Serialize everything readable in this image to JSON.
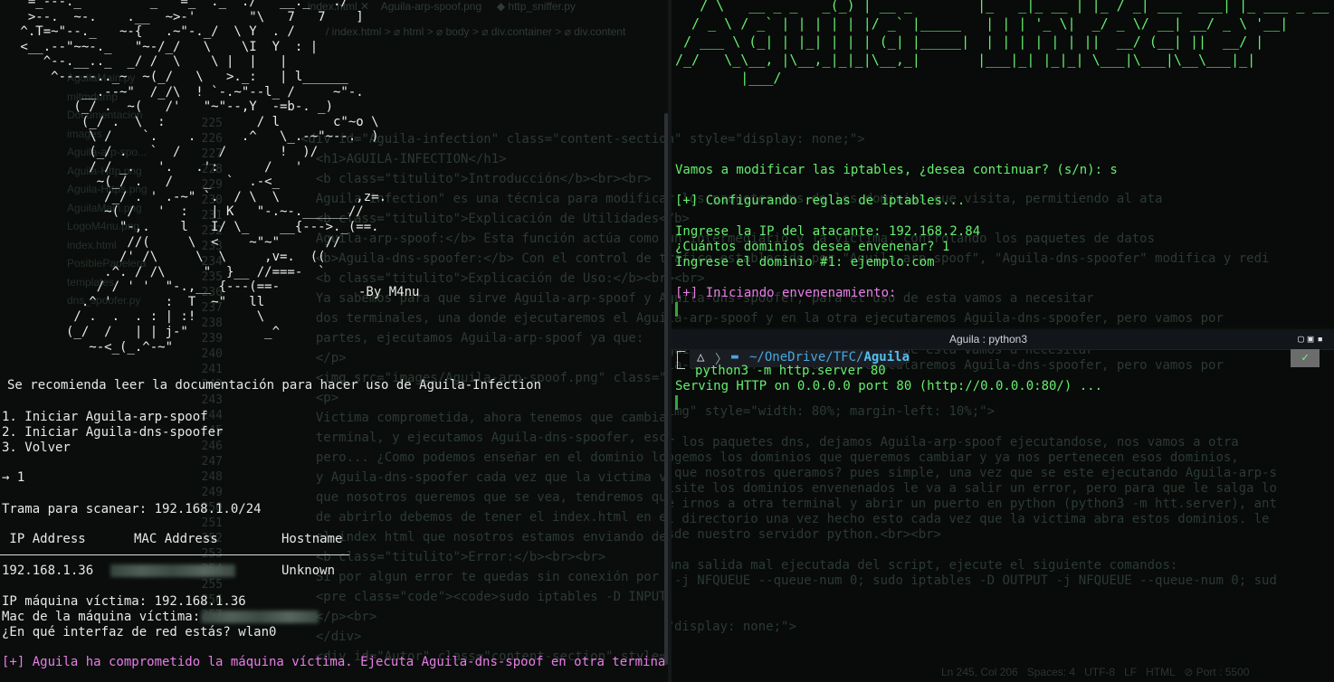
{
  "left": {
    "ascii_logo": "  =_---._         _   =_  ._  ./   __._   ./\n  >--.  ~-.    .__  ~>-'       \"\\   7   7    ]\n ^.T=~\"--._   ~-{   .~\"-._/  \\ Y  . /\n <__.--\"~~-._   \"~-/_/   \\    \\I  Y  : |\n    ^--.__.._  _/ /  \\    \\ |  |   |    \n     ^-----.._~  ~(_/   \\   >._:   | l______\n         __.--~\"  /_/\\  ! `-.~\"--l_ /     ~\"-.\n        (_/ .  ~(   /'   \"~\"--,Y  -=b-. _)\n         (_/ .  \\  :            / l       c\"~o \\\n          \\ /    `.    .      .^   \\_.-~\"~--.  )\n          (_/ .   `  /     /       !  )/\n          / / _.   '.   .':      /   '\n           ~(_/ .   /    _  `  .-<_\n            /_/ . ' .-~\" `.  / \\  \\          ,z=.\n            ~( /   '  :   | K   \"-.~-.______//\n              \"-,.    l   I/ \\_    __{--->._(==.\n               //(     \\  <    ~\"~\"      //\n              /' /\\     \\  \\     ,v=.  ((\n            .^. / /\\     \"  }__ //===-  `\n           / / ' '  \"-.,__ {---(==-\n         .^ '       :  T  ~\"   ll\n        / .  .  . : | :!        \\\n       (_/  /   | | j-\"          _^\n          ~-<_(_.^-~\"",
    "signature": "-By M4nu",
    "recommend": "Se recomienda leer la documentación para hacer uso de Aguila-Infection",
    "menu": [
      "1. Iniciar Aguila-arp-spoof",
      "2. Iniciar Aguila-dns-spoofer",
      "3. Volver"
    ],
    "prompt_arrow": "→ 1",
    "scan_line": "Trama para scanear: 192.168.1.0/24",
    "table_headers": [
      " IP Address",
      "MAC Address",
      "Hostname"
    ],
    "table_rows": [
      {
        "ip": "192.168.1.36",
        "hostname": "Unknown"
      }
    ],
    "ip_victim": "IP máquina víctima: 192.168.1.36",
    "mac_victim": "Mac de la máquina víctima:",
    "interface": "¿En qué interfaz de red estás? wlan0",
    "compromised": "[+] Aguila ha comprometido la máquina víctima. Ejecuta Aguila-dns-spoof en otra terminal para"
  },
  "underlay": {
    "tabs": "index.html ✕    Aguila-arp-spoof.png     ◆ http_sniffer.py",
    "breadcrumb": "/ index.html > ⌀ html > ⌀ body > ⌀ div.container > ⌀ div.content",
    "sidebar": [
      "AguilaMain.py",
      "mitmdump",
      "Documentacion",
      "images",
      "Aguila-arp-spo...",
      "Aguila-Http.png",
      "Aguila-Https.png",
      "AguilaMain.png",
      "LogoM4nu.png",
      "index.html",
      "PosiblePapelera",
      "templates",
      "dns_spoofer.py"
    ],
    "code": [
      "<div id=\"Aguila-infection\" class=\"content-section\" style=\"display: none;\">",
      "  <h1>AGUILA-INFECTION</h1>",
      "  <b class=\"titulito\">Introducción</b><br><br>",
      "  Aguila-infection\" es una técnica para modificar los paquetes dns de los dominios que visita, permitiendo al ata",
      "  <b class=\"titulito\">Explicación de Utilidades</b>",
      "  Aguila-arp-spoof:</b> Esta función actúa como un intermediario y la víctima, controlando los paquetes de datos",
      "  <b>Aguila-dns-spoofer:</b> Con el control de tráfico establecido por \"Aguila-arp-spoof\", \"Aguila-dns-spoofer\" modifica y redi",
      "  <b class=\"titulito\">Explicación de Uso:</b><br><br>",
      "  Ya sabemos para que sirve Aguila-arp-spoof y Aguila-dns-spoofer, para el uso de esta vamos a necesitar",
      "  dos terminales, una donde ejecutaremos el Aguila-arp-spoof y en la otra ejecutaremos Aguila-dns-spoofer, pero vamos por",
      "  partes, ejecutamos Aguila-arp-spoof ya que:",
      "  </p>",
      "  <img src=\"images/Aguila-arp-spoof.png\" class=\"img\" style=\"width: 80%; margin-left: 10%;\">",
      "  <p>",
      "  Victima comprometida, ahora tenemos que cambiar los paquetes dns, dejamos Aguila-arp-spoof ejecutandose, nos vamos a otra",
      "  terminal, y ejecutamos Aguila-dns-spoofer, escogemos los dominios que queremos cambiar y ya nos pertenecen esos dominios,",
      "  pero... ¿Como podemos enseñar en el dominio lo que nosotros queramos? pues simple, una vez que se este ejecutando Aguila-arp-s",
      "  y Aguila-dns-spoofer cada vez que la victima visite los dominios envenenados le va a salir un error, pero para que le salga lo",
      "  que nosotros queremos que se vea, tendremos que irnos a otra terminal y abrir un puerto en python (python3 -m htt.server), ant",
      "  de abrirlo debemos de tener el index.html en el directorio una vez hecho esto cada vez que la victima abra estos dominios. le",
      "  el index html que nosotros estamos enviando desde nuestro servidor python.<br><br>",
      "  <b class=\"titulito\">Error:</b><br><br>",
      "  Si por algun error te quedas sin conexión por una salida mal ejecutada del script, ejecute el siguiente comandos:",
      "  <pre class=\"code\"><code>sudo iptables -D INPUT -j NFQUEUE --queue-num 0; sudo iptables -D OUTPUT -j NFQUEUE --queue-num 0; sud",
      "  </p><br>",
      "  </div>",
      "  <div id=\"Autor\" class=\"content-section\" style=\"display: none;\">"
    ],
    "status": "Ln 245, Col 206   Spaces: 4   UTF-8   LF   HTML   ⊘ Port : 5500"
  },
  "right_top": {
    "banner": "   / \\   __ _ _   _(_) | __ _        |_   _|_ __ | |_ / _| ___  ___| |_ ___ _ __\n  / _ \\ / _` | | | | | |/ _` |_____   | | | '_ \\|  _/ _ \\/ __| __/ _ \\ '__|\n / ___ \\ (_| | |_| | | | (_| |_____|  | | | | | | ||  __/ (__| ||  __/ |\n/_/   \\_\\__, |\\__,_|_|_|\\__,_|       |___|_| |_|_| \\___|\\___|\\__\\___|_|\n        |___/",
    "question": "Vamos a modificar las iptables, ¿desea continuar? (s/n): s",
    "config": "[+] Configurando reglas de iptables...",
    "attacker_ip": "Ingrese la IP del atacante: 192.168.2.84",
    "domains_count": "¿Cuántos dominios desea envenenar? 1",
    "domain1": "Ingrese el dominio #1: ejemplo.com",
    "starting": "[+] Iniciando envenenamiento:"
  },
  "right_bottom": {
    "title": "Aguila : python3",
    "path_prefix": "~/OneDrive/TFC/",
    "path_dir": "Aguila",
    "command": "python3 -m http.server 80",
    "serving": "Serving HTTP on 0.0.0.0 port 80 (http://0.0.0.0:80/) ...",
    "check": "✓"
  },
  "colors": {
    "green": "#66ee6f",
    "pink": "#e97ce9",
    "cyan": "#52c7ee",
    "background": "#0a0d0b"
  }
}
